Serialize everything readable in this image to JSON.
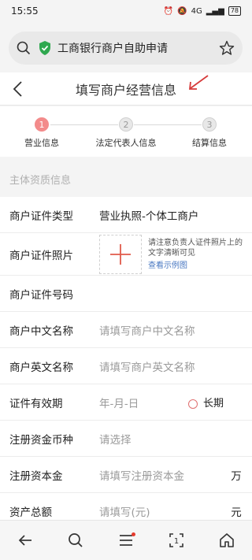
{
  "status": {
    "time": "15:55",
    "network": "4G",
    "battery": "78"
  },
  "browser": {
    "title": "工商银行商户自助申请"
  },
  "header": {
    "title": "填写商户经营信息"
  },
  "steps": [
    {
      "num": "1",
      "label": "营业信息"
    },
    {
      "num": "2",
      "label": "法定代表人信息"
    },
    {
      "num": "3",
      "label": "结算信息"
    }
  ],
  "section": {
    "title": "主体资质信息"
  },
  "form": {
    "cert_type": {
      "label": "商户证件类型",
      "value": "营业执照-个体工商户"
    },
    "cert_photo": {
      "label": "商户证件照片",
      "note": "请注意负责人证件照片上的文字清晰可见",
      "link": "查看示例图"
    },
    "cert_number": {
      "label": "商户证件号码"
    },
    "cn_name": {
      "label": "商户中文名称",
      "placeholder": "请填写商户中文名称"
    },
    "en_name": {
      "label": "商户英文名称",
      "placeholder": "请填写商户英文名称"
    },
    "validity": {
      "label": "证件有效期",
      "placeholder": "年-月-日",
      "long_term": "长期"
    },
    "currency": {
      "label": "注册资金币种",
      "placeholder": "请选择"
    },
    "capital": {
      "label": "注册资本金",
      "placeholder": "请填写注册资本金",
      "unit": "万"
    },
    "assets": {
      "label": "资产总额",
      "placeholder": "请填写(元)",
      "unit": "元"
    }
  },
  "colors": {
    "accent": "#f38b8b",
    "link": "#4a78c2",
    "plus": "#e05a4a"
  }
}
